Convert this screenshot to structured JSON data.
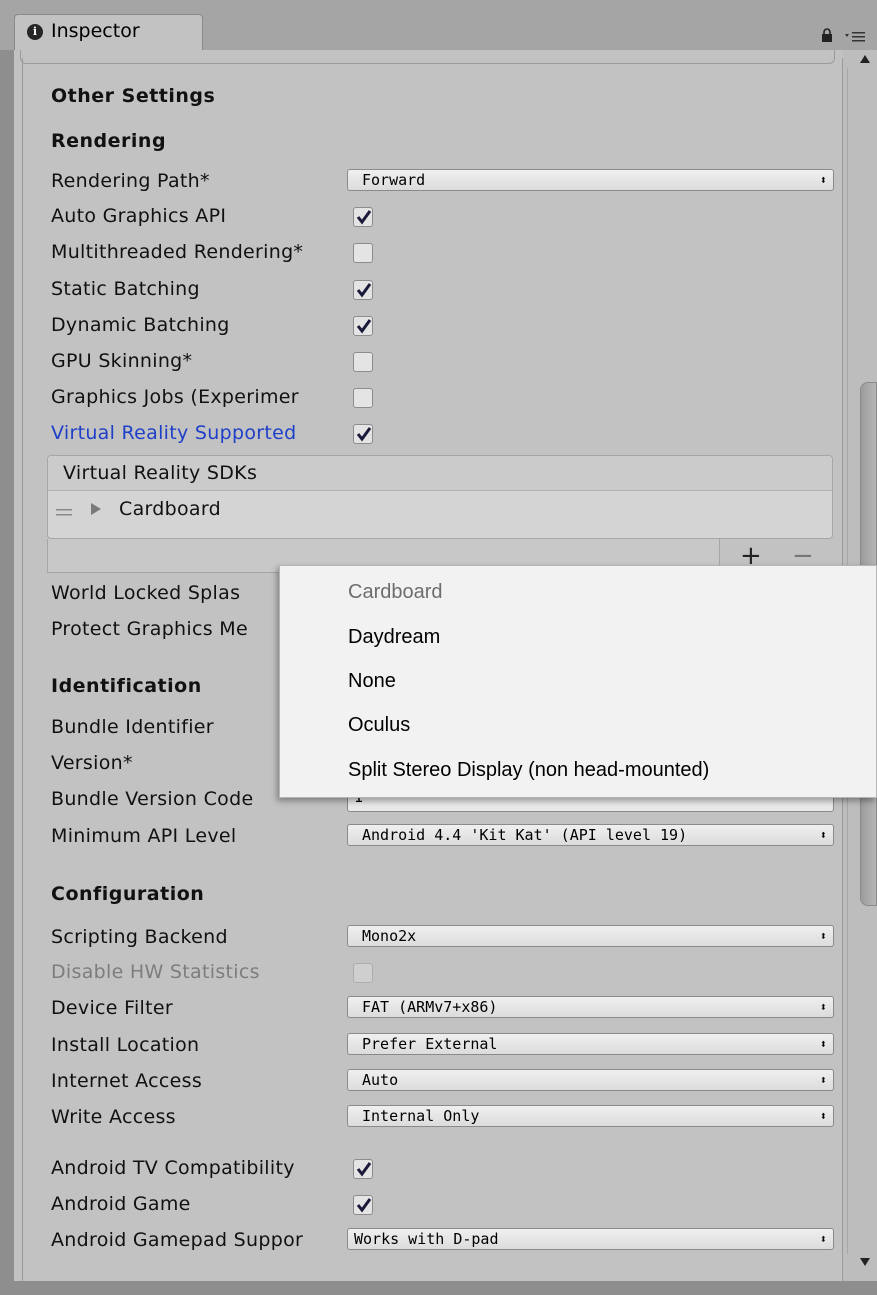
{
  "window": {
    "tab_title": "Inspector"
  },
  "sections": {
    "other_settings": "Other Settings",
    "rendering": "Rendering",
    "identification": "Identification",
    "configuration": "Configuration"
  },
  "rendering": {
    "rendering_path_label": "Rendering Path*",
    "rendering_path_value": "Forward",
    "auto_graphics_api_label": "Auto Graphics API",
    "auto_graphics_api_checked": true,
    "multithreaded_label": "Multithreaded Rendering*",
    "multithreaded_checked": false,
    "static_batching_label": "Static Batching",
    "static_batching_checked": true,
    "dynamic_batching_label": "Dynamic Batching",
    "dynamic_batching_checked": true,
    "gpu_skinning_label": "GPU Skinning*",
    "gpu_skinning_checked": false,
    "graphics_jobs_label": "Graphics Jobs (Experimer",
    "graphics_jobs_checked": false,
    "vr_supported_label": "Virtual Reality Supported",
    "vr_supported_checked": true,
    "vr_sdks_header": "Virtual Reality SDKs",
    "vr_sdk_items": [
      "Cardboard"
    ],
    "add_symbol": "+",
    "remove_symbol": "−",
    "world_locked_label": "World Locked Splas",
    "protect_graphics_label": "Protect Graphics Me"
  },
  "identification": {
    "bundle_identifier_label": "Bundle Identifier",
    "version_label": "Version*",
    "bundle_version_code_label": "Bundle Version Code",
    "bundle_version_code_value": "1",
    "minimum_api_label": "Minimum API Level",
    "minimum_api_value": "Android 4.4 'Kit Kat' (API level 19)"
  },
  "configuration": {
    "scripting_backend_label": "Scripting Backend",
    "scripting_backend_value": "Mono2x",
    "disable_hw_stats_label": "Disable HW Statistics",
    "disable_hw_stats_checked": false,
    "device_filter_label": "Device Filter",
    "device_filter_value": "FAT (ARMv7+x86)",
    "install_location_label": "Install Location",
    "install_location_value": "Prefer External",
    "internet_access_label": "Internet Access",
    "internet_access_value": "Auto",
    "write_access_label": "Write Access",
    "write_access_value": "Internal Only",
    "android_tv_label": "Android TV Compatibility",
    "android_tv_checked": true,
    "android_game_label": "Android Game",
    "android_game_checked": true,
    "gamepad_label": "Android Gamepad Suppor",
    "gamepad_value": "Works with D-pad"
  },
  "popup_menu": {
    "items": [
      "Cardboard",
      "Daydream",
      "None",
      "Oculus",
      "Split Stereo Display (non head-mounted)"
    ],
    "disabled_item": "Cardboard"
  },
  "icons": {
    "info": "info-icon",
    "lock": "lock-icon",
    "menu": "menu-icon",
    "dropdown_arrow": "updown-arrow-icon",
    "drag_handle": "drag-handle-icon",
    "foldout": "triangle-right-icon",
    "check": "check-icon"
  },
  "colors": {
    "panel_bg": "#c2c2c2",
    "accent_blue": "#1e3fc7",
    "popup_bg": "#f2f2f2"
  }
}
